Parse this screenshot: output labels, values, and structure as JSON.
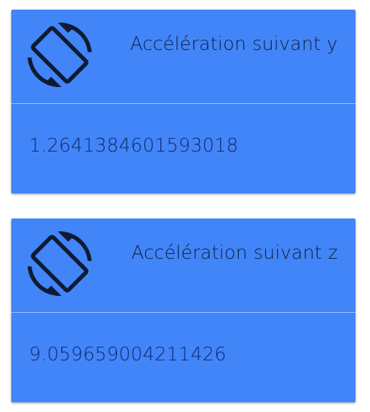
{
  "colors": {
    "card_background": "#4285f8",
    "title_text": "#102040",
    "value_text": "#102a6a",
    "icon": "#0f1a33"
  },
  "cards": [
    {
      "icon": "screen-rotation-icon",
      "title": "Accélération suivant y",
      "value": "1.2641384601593018"
    },
    {
      "icon": "screen-rotation-icon",
      "title": "Accélération suivant z",
      "value": "9.059659004211426"
    }
  ]
}
